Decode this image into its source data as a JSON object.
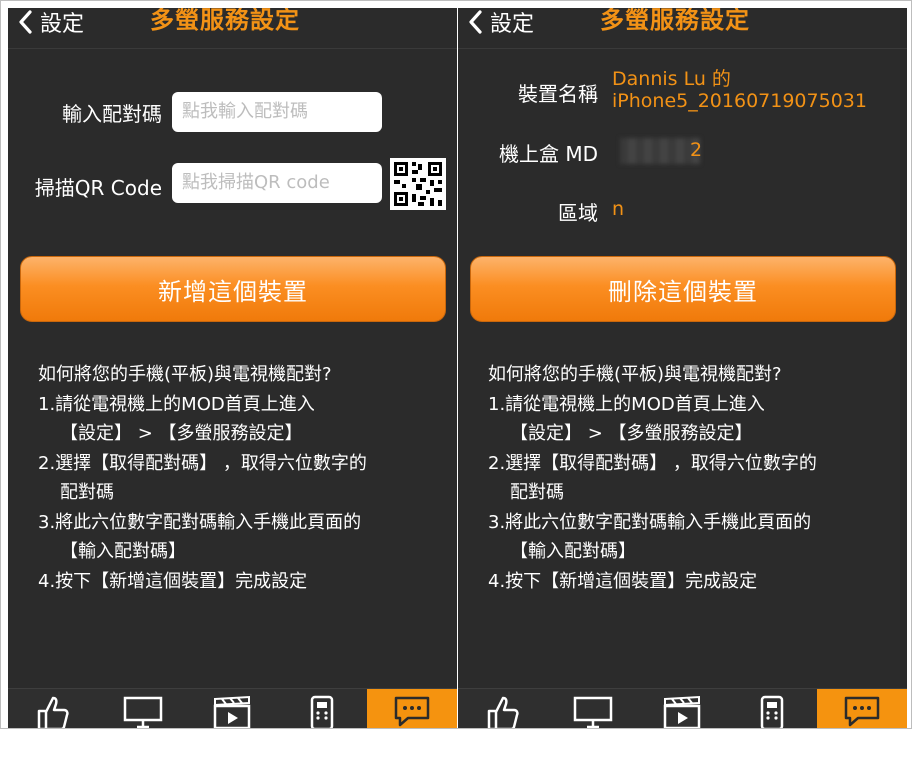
{
  "left": {
    "nav": {
      "back_label": "設定",
      "title": "多螢服務設定"
    },
    "pairing_code": {
      "label": "輸入配對碼",
      "placeholder": "點我輸入配對碼"
    },
    "qr_scan": {
      "label": "掃描QR Code",
      "placeholder": "點我掃描QR code"
    },
    "add_button": "新增這個裝置"
  },
  "right": {
    "nav": {
      "back_label": "設定",
      "title": "多螢服務設定"
    },
    "device_name": {
      "label": "裝置名稱",
      "value_line1": "Dannis Lu 的",
      "value_line2": "iPhone5_20160719075031"
    },
    "stb_md": {
      "label": "機上盒 MD",
      "value_suffix": "2"
    },
    "region": {
      "label": "區域",
      "value": "n"
    },
    "delete_button": "刪除這個裝置"
  },
  "instructions": [
    "如何將您的手機(平板)與電視機配對?",
    "1.請從電視機上的MOD首頁上進入",
    "【設定】 > 【多螢服務設定】",
    "2.選擇【取得配對碼】 ，取得六位數字的",
    "配對碼",
    "3.將此六位數字配對碼輸入手機此頁面的",
    "【輸入配對碼】",
    "4.按下【新增這個裝置】完成設定"
  ],
  "tabs": [
    {
      "icon": "thumbs-up-icon",
      "active": false
    },
    {
      "icon": "tv-icon",
      "active": false
    },
    {
      "icon": "film-clapper-icon",
      "active": false
    },
    {
      "icon": "remote-control-icon",
      "active": false
    },
    {
      "icon": "chat-bubble-icon",
      "active": true
    }
  ],
  "colors": {
    "accent": "#f29216",
    "background": "#2b2b2b",
    "button": "#fb8e22"
  }
}
